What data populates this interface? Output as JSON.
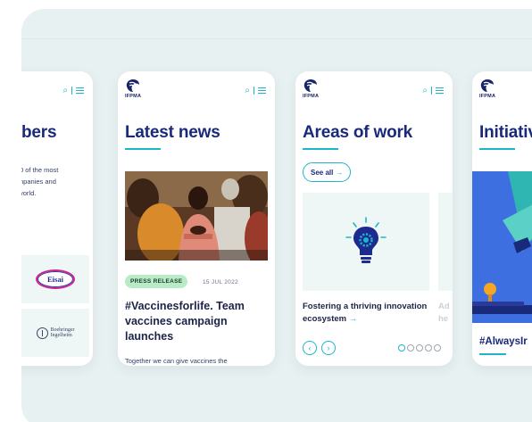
{
  "brand": {
    "logo_text": "IFPMA",
    "primary": "#1a2a7a",
    "accent": "#1fb5c8",
    "background": "#e8f1f1"
  },
  "header_icons": [
    "search-icon",
    "menu-icon"
  ],
  "members": {
    "title_fragment": "bers",
    "description_lines": [
      "0 of the most",
      "npanies and",
      "vorld."
    ],
    "logos": [
      {
        "name": "Eisai",
        "icon": "eisai-logo"
      },
      {
        "lines": [
          "Boehringer",
          "Ingelheim"
        ],
        "icon": "boehringer-ingelheim-logo"
      }
    ]
  },
  "news": {
    "title": "Latest news",
    "badge": "PRESS RELEASE",
    "date": "15 JUL 2022",
    "headline": "#Vaccinesforlife. Team vaccines campaign launches",
    "body": "Together we can give vaccines the"
  },
  "areas": {
    "title": "Areas of work",
    "see_all": "See all",
    "card_icon": "lightbulb-gear-icon",
    "caption": "Fostering a thriving innovation ecosystem",
    "caption_next_lines": [
      "Ad",
      "he"
    ],
    "carousel_count": 5,
    "carousel_active": 1
  },
  "initiatives": {
    "title": "Initiativ",
    "hashtag": "#AlwaysIr"
  }
}
